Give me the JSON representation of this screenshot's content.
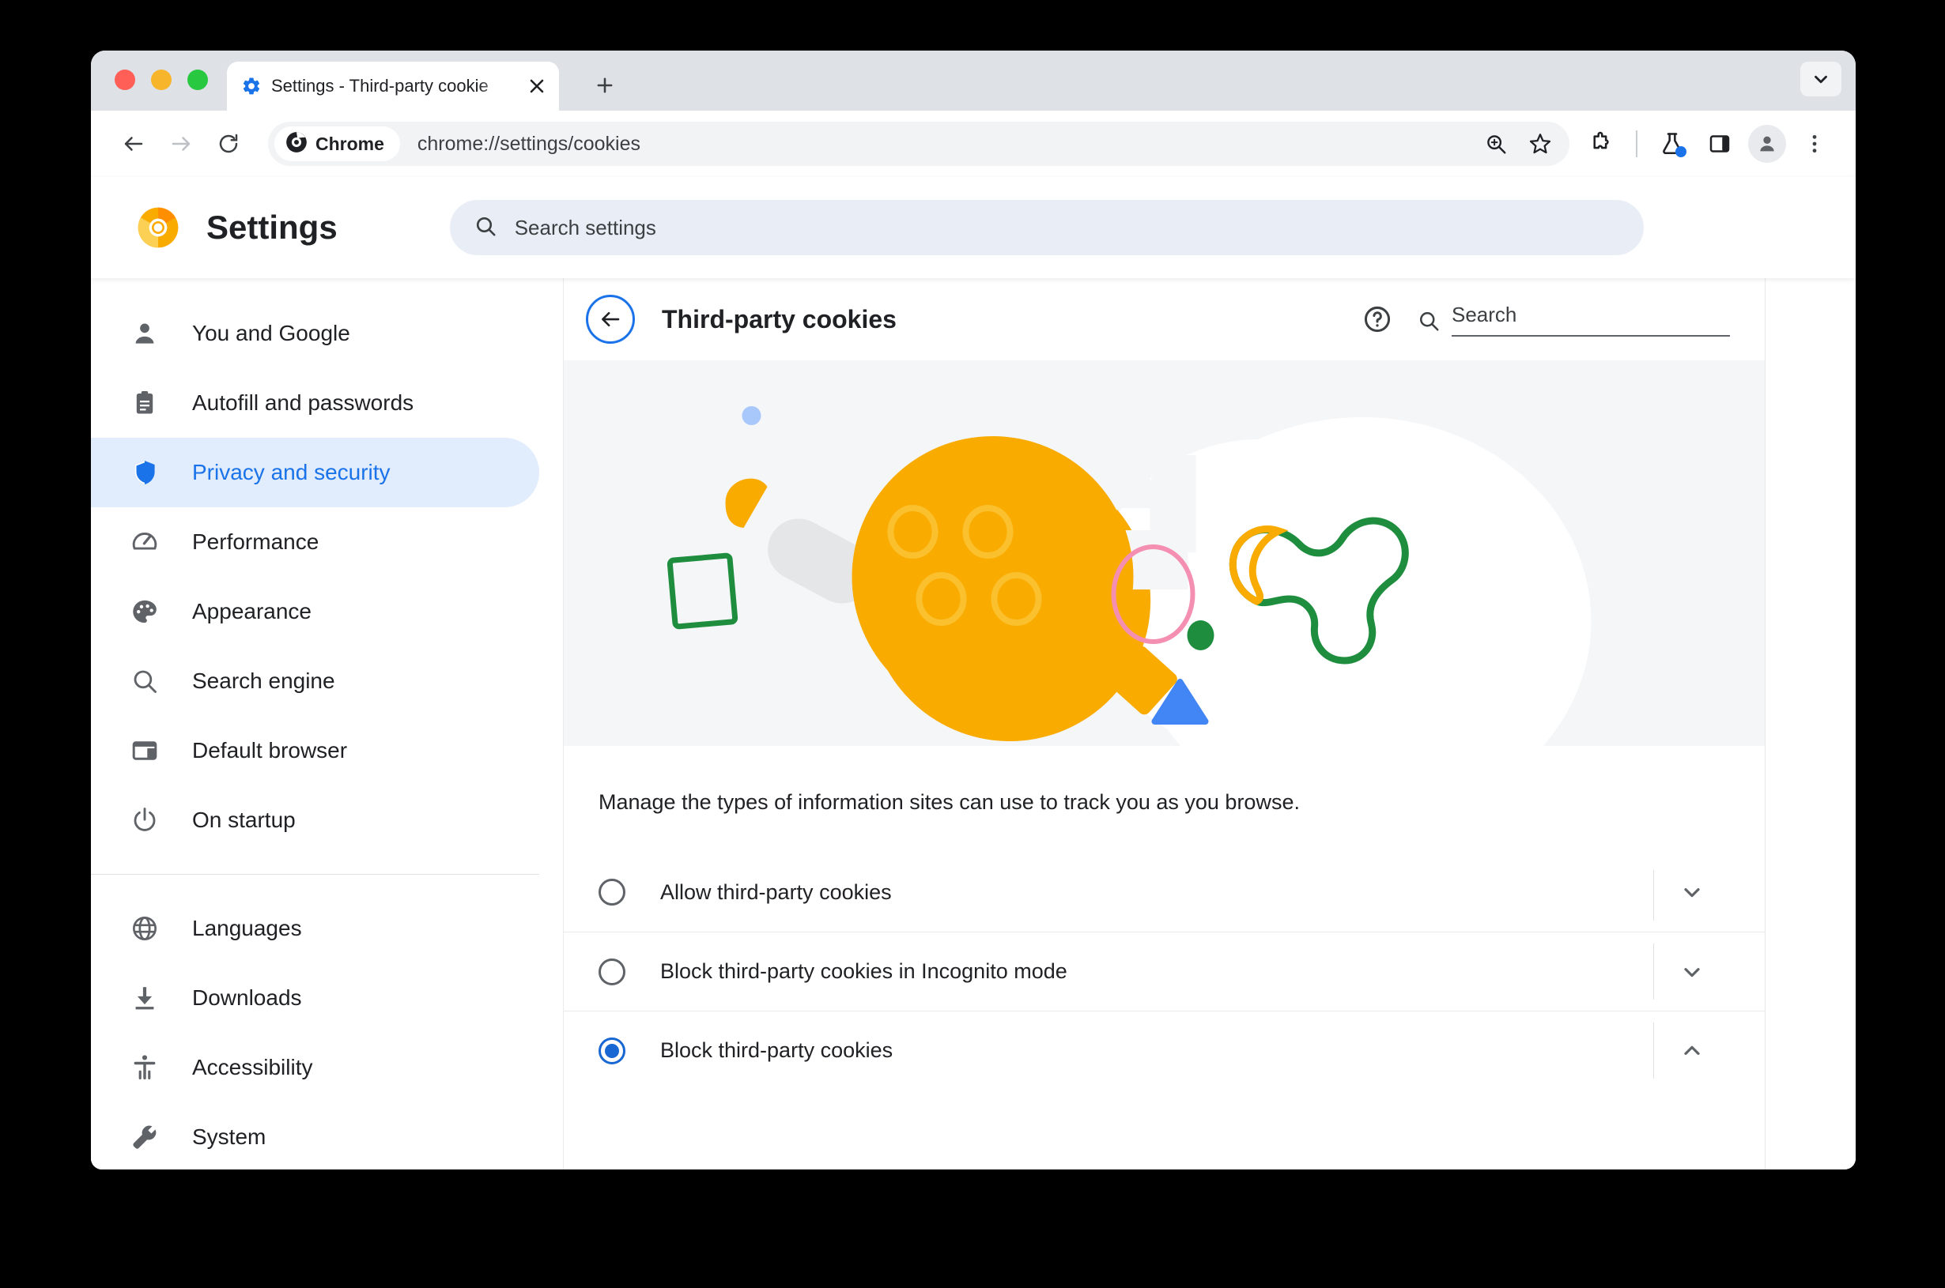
{
  "window": {
    "traffic_lights": [
      "close",
      "minimize",
      "maximize"
    ],
    "colors": {
      "close": "#ff5f57",
      "minimize": "#f7b52b",
      "maximize": "#28c840",
      "tabstrip_bg": "#dee1e6",
      "accent_blue": "#1a73e8",
      "cookie_yellow": "#f9ab00",
      "illustration_bg": "#f4f6f8"
    }
  },
  "tab": {
    "title": "Settings - Third-party cookie",
    "favicon": "gear-icon",
    "close_icon": "close-icon",
    "new_tab_icon": "plus-icon",
    "tab_search_icon": "chevron-down-icon"
  },
  "toolbar": {
    "back_icon": "arrow-left-icon",
    "forward_icon": "arrow-right-icon",
    "reload_icon": "reload-icon",
    "chip_label": "Chrome",
    "chip_icon": "chrome-icon",
    "url": "chrome://settings/cookies",
    "zoom_icon": "zoom-in-icon",
    "bookmark_icon": "star-icon",
    "extensions_icon": "puzzle-piece-icon",
    "experiments_icon": "flask-icon",
    "side_panel_icon": "side-panel-icon",
    "profile_icon": "person-icon",
    "menu_icon": "three-dot-menu-icon"
  },
  "settings_header": {
    "logo": "chrome-canary-logo",
    "title": "Settings",
    "search_icon": "search-icon",
    "search_placeholder": "Search settings",
    "search_value": ""
  },
  "sidebar": {
    "group_primary": [
      {
        "label": "You and Google",
        "icon": "person-icon",
        "selected": false
      },
      {
        "label": "Autofill and passwords",
        "icon": "clipboard-icon",
        "selected": false
      },
      {
        "label": "Privacy and security",
        "icon": "shield-icon",
        "selected": true
      },
      {
        "label": "Performance",
        "icon": "speedometer-icon",
        "selected": false
      },
      {
        "label": "Appearance",
        "icon": "palette-icon",
        "selected": false
      },
      {
        "label": "Search engine",
        "icon": "search-icon",
        "selected": false
      },
      {
        "label": "Default browser",
        "icon": "browser-window-icon",
        "selected": false
      },
      {
        "label": "On startup",
        "icon": "power-icon",
        "selected": false
      }
    ],
    "group_secondary": [
      {
        "label": "Languages",
        "icon": "globe-icon",
        "selected": false
      },
      {
        "label": "Downloads",
        "icon": "download-icon",
        "selected": false
      },
      {
        "label": "Accessibility",
        "icon": "accessibility-icon",
        "selected": false
      },
      {
        "label": "System",
        "icon": "wrench-icon",
        "selected": false
      }
    ]
  },
  "content": {
    "back_icon": "arrow-left-icon",
    "heading": "Third-party cookies",
    "help_icon": "help-circle-icon",
    "search_icon": "search-icon",
    "search_placeholder": "Search",
    "search_value": "",
    "illustration_name": "cookie-illustration",
    "description": "Manage the types of information sites can use to track you as you browse.",
    "options": [
      {
        "label": "Allow third-party cookies",
        "selected": false,
        "expand_icon": "chevron-down-icon"
      },
      {
        "label": "Block third-party cookies in Incognito mode",
        "selected": false,
        "expand_icon": "chevron-down-icon"
      },
      {
        "label": "Block third-party cookies",
        "selected": true,
        "expand_icon": "chevron-up-icon"
      }
    ]
  }
}
